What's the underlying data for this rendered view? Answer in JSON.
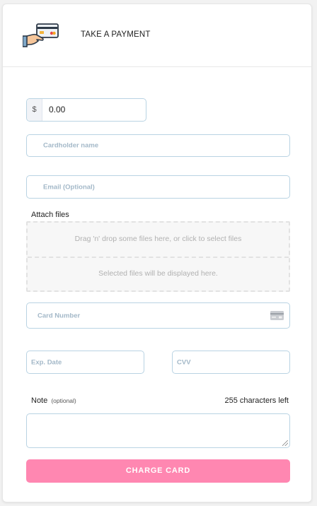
{
  "header": {
    "title": "TAKE A PAYMENT",
    "logo_icon": "hand-holding-card-icon"
  },
  "form": {
    "amount": {
      "currency_symbol": "$",
      "value": "0.00"
    },
    "cardholder": {
      "placeholder": "Cardholder name"
    },
    "email": {
      "placeholder": "Email (Optional)"
    },
    "attach": {
      "label": "Attach files",
      "drop_text": "Drag 'n' drop some files here, or click to select files",
      "selected_text": "Selected files will be displayed here."
    },
    "card_number": {
      "placeholder": "Card Number",
      "icon": "credit-card-icon"
    },
    "exp_date": {
      "placeholder": "Exp. Date"
    },
    "cvv": {
      "placeholder": "CVV"
    },
    "note": {
      "label": "Note",
      "optional": "(optional)",
      "chars_left": "255 characters left"
    },
    "submit_label": "CHARGE CARD"
  },
  "colors": {
    "accent": "#ff87b1",
    "field_border": "#b9d3e3",
    "placeholder": "#a3b8c8"
  }
}
